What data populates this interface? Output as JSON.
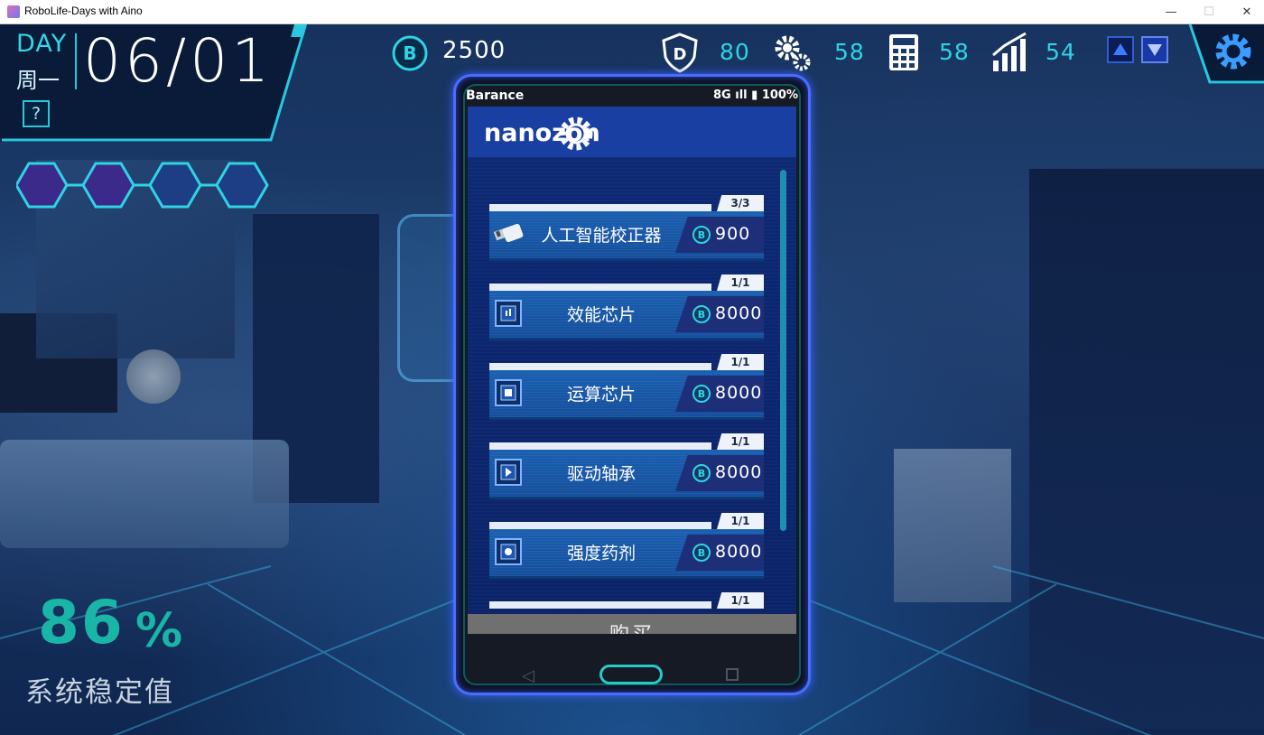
{
  "window": {
    "title": "RoboLife-Days with Aino"
  },
  "hud": {
    "day_label": "DAY",
    "weekday": "周一",
    "date": "06/01",
    "help_label": "?",
    "coins": "2500",
    "stats": [
      {
        "icon": "shield-icon",
        "value": "80"
      },
      {
        "icon": "gears-icon",
        "value": "58"
      },
      {
        "icon": "calculator-icon",
        "value": "58"
      },
      {
        "icon": "growth-chart-icon",
        "value": "54"
      }
    ],
    "stability_value": "86",
    "stability_unit": "%",
    "stability_label": "系统稳定值"
  },
  "phone": {
    "carrier": "Barance",
    "status": "8G ıll ▮ 100%",
    "shop_name": "nanozon",
    "items": [
      {
        "name": "人工智能校正器",
        "price": "900",
        "stock": "3/3",
        "icon": "usb-drive-icon"
      },
      {
        "name": "效能芯片",
        "price": "8000",
        "stock": "1/1",
        "icon": "chip-icon"
      },
      {
        "name": "运算芯片",
        "price": "8000",
        "stock": "1/1",
        "icon": "chip-icon"
      },
      {
        "name": "驱动轴承",
        "price": "8000",
        "stock": "1/1",
        "icon": "chip-icon"
      },
      {
        "name": "强度药剂",
        "price": "8000",
        "stock": "1/1",
        "icon": "chip-icon"
      },
      {
        "name": "",
        "price": "",
        "stock": "1/1",
        "icon": ""
      }
    ],
    "buy_label": "购买"
  },
  "colors": {
    "accent": "#2fd3e4",
    "phone_border": "#4a6cff",
    "stability": "#19b6a8"
  }
}
